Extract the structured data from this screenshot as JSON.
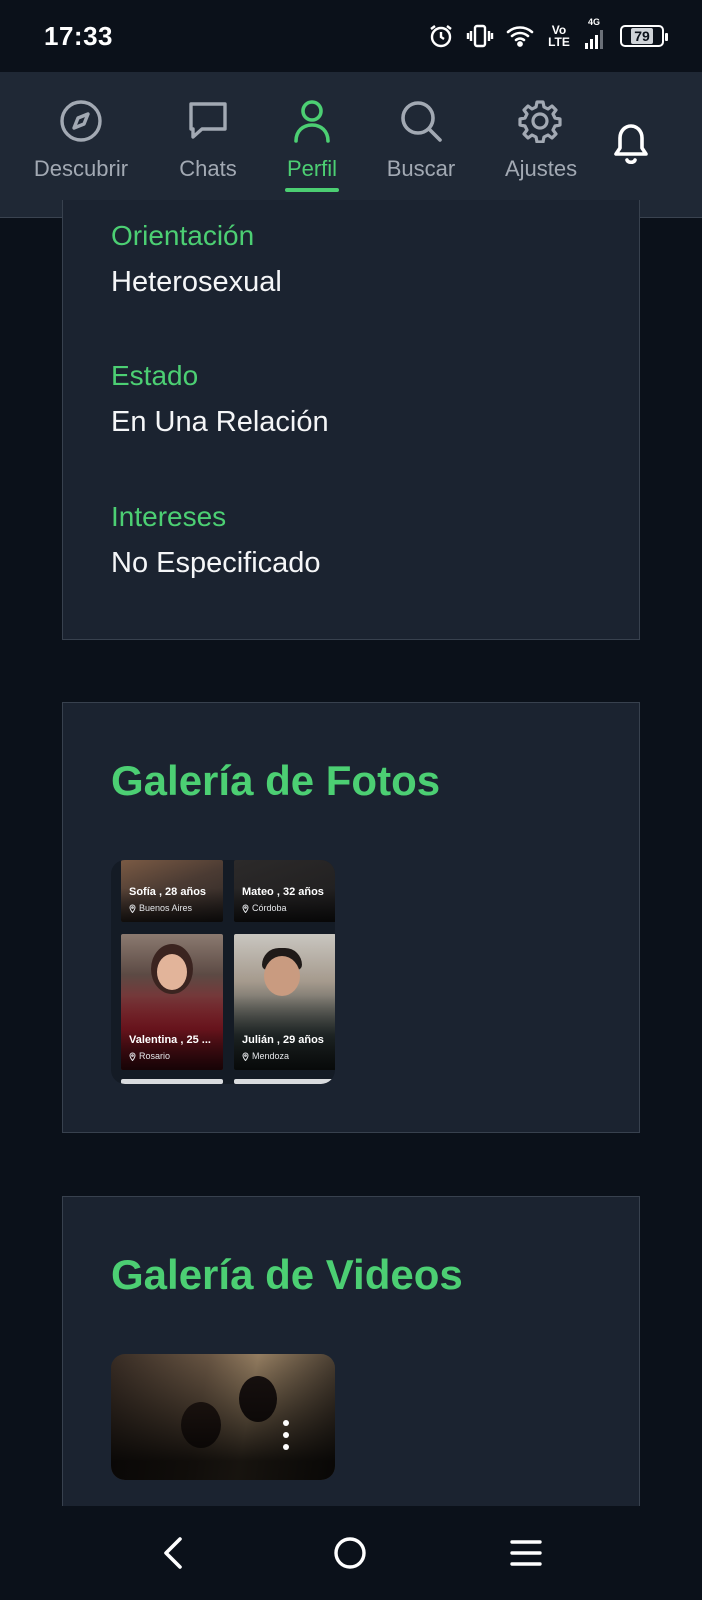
{
  "status_bar": {
    "time": "17:33",
    "network": "Vo LTE",
    "signal": "4G",
    "battery": "79"
  },
  "nav": {
    "items": [
      {
        "label": "Descubrir",
        "icon": "compass-icon"
      },
      {
        "label": "Chats",
        "icon": "chat-icon"
      },
      {
        "label": "Perfil",
        "icon": "user-icon",
        "active": true
      },
      {
        "label": "Buscar",
        "icon": "search-icon"
      },
      {
        "label": "Ajustes",
        "icon": "gear-icon"
      }
    ],
    "notifications_icon": "bell-icon"
  },
  "profile_info": {
    "fields": [
      {
        "label": "Orientación",
        "value": "Heterosexual"
      },
      {
        "label": "Estado",
        "value": "En Una Relación"
      },
      {
        "label": "Intereses",
        "value": "No Especificado"
      }
    ]
  },
  "photo_gallery": {
    "title": "Galería de Fotos",
    "photos": [
      {
        "name": "Sofía , 28 años",
        "location": "Buenos Aires"
      },
      {
        "name": "Mateo , 32 años",
        "location": "Córdoba"
      },
      {
        "name": "Valentina , 25 ...",
        "location": "Rosario"
      },
      {
        "name": "Julián , 29 años",
        "location": "Mendoza"
      }
    ]
  },
  "video_gallery": {
    "title": "Galería de Videos"
  },
  "colors": {
    "accent": "#4ccf73",
    "background": "#0b111a",
    "card": "#1b2330",
    "nav": "#1f2835"
  }
}
